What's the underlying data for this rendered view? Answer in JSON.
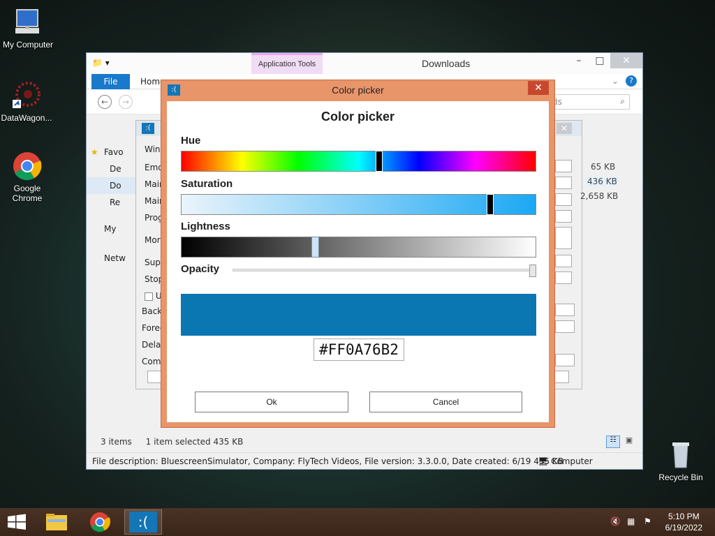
{
  "desktop": {
    "icons": [
      {
        "label": "My Computer"
      },
      {
        "label": "DataWagon..."
      },
      {
        "label": "Google Chrome"
      },
      {
        "label": "Recycle Bin"
      }
    ]
  },
  "explorer": {
    "title": "Downloads",
    "app_tools": "Application Tools",
    "ribbon": {
      "file": "File",
      "home": "Home"
    },
    "search_placeholder": "ds",
    "sidebar": [
      "Favo",
      "De",
      "Do",
      "Re",
      "My",
      "Netw"
    ],
    "inner_rows": [
      "Wind",
      "Emo",
      "Main",
      "Main",
      "Prog",
      "More",
      "Supp",
      "Stop",
      "U",
      "Backg",
      "Foreg",
      "Delay",
      "Comr"
    ],
    "sizes": [
      "65 KB",
      "436 KB",
      "2,658 KB"
    ],
    "status_items": "3 items",
    "status_selected": "1 item selected  435 KB",
    "details": "File description: BluescreenSimulator, Company: FlyTech Videos, File version: 3.3.0.0, Date created: 6/19  435 KB",
    "details_location": "Computer"
  },
  "dialog": {
    "window_title": "Color picker",
    "logo": ":(",
    "heading": "Color picker",
    "hue_label": "Hue",
    "saturation_label": "Saturation",
    "lightness_label": "Lightness",
    "opacity_label": "Opacity",
    "hue_value": 0.56,
    "saturation_value": 0.88,
    "lightness_value": 0.375,
    "opacity_value": 1.0,
    "hex_value": "#FF0A76B2",
    "preview_color": "#0A76B2",
    "ok_label": "Ok",
    "cancel_label": "Cancel"
  },
  "taskbar": {
    "time": "5:10 PM",
    "date": "6/19/2022"
  }
}
